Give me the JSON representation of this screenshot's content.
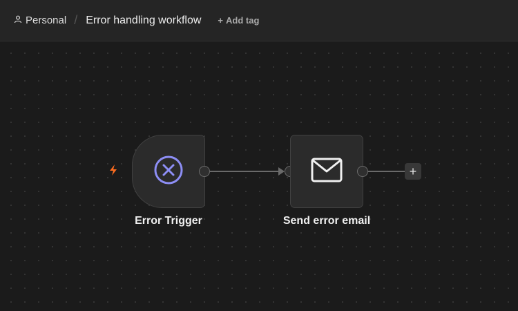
{
  "header": {
    "breadcrumb_home": "Personal",
    "breadcrumb_home_icon": "user-icon",
    "separator": "/",
    "workflow_title": "Error handling workflow",
    "add_tag_label": "Add tag",
    "add_tag_icon": "plus-icon"
  },
  "nodes": [
    {
      "label": "Error Trigger",
      "icon": "circle-x-icon",
      "icon_color": "#8d8ef5",
      "trigger_icon": "lightning-bolt-icon",
      "trigger_icon_color": "#ff6d1f"
    },
    {
      "label": "Send error email",
      "icon": "envelope-icon",
      "icon_color": "#f0f0f0"
    }
  ],
  "canvas": {
    "add_node_label": "+",
    "colors": {
      "background": "#1b1b1b",
      "node_fill": "#2b2b2b",
      "edge": "#6a6a6a"
    }
  }
}
